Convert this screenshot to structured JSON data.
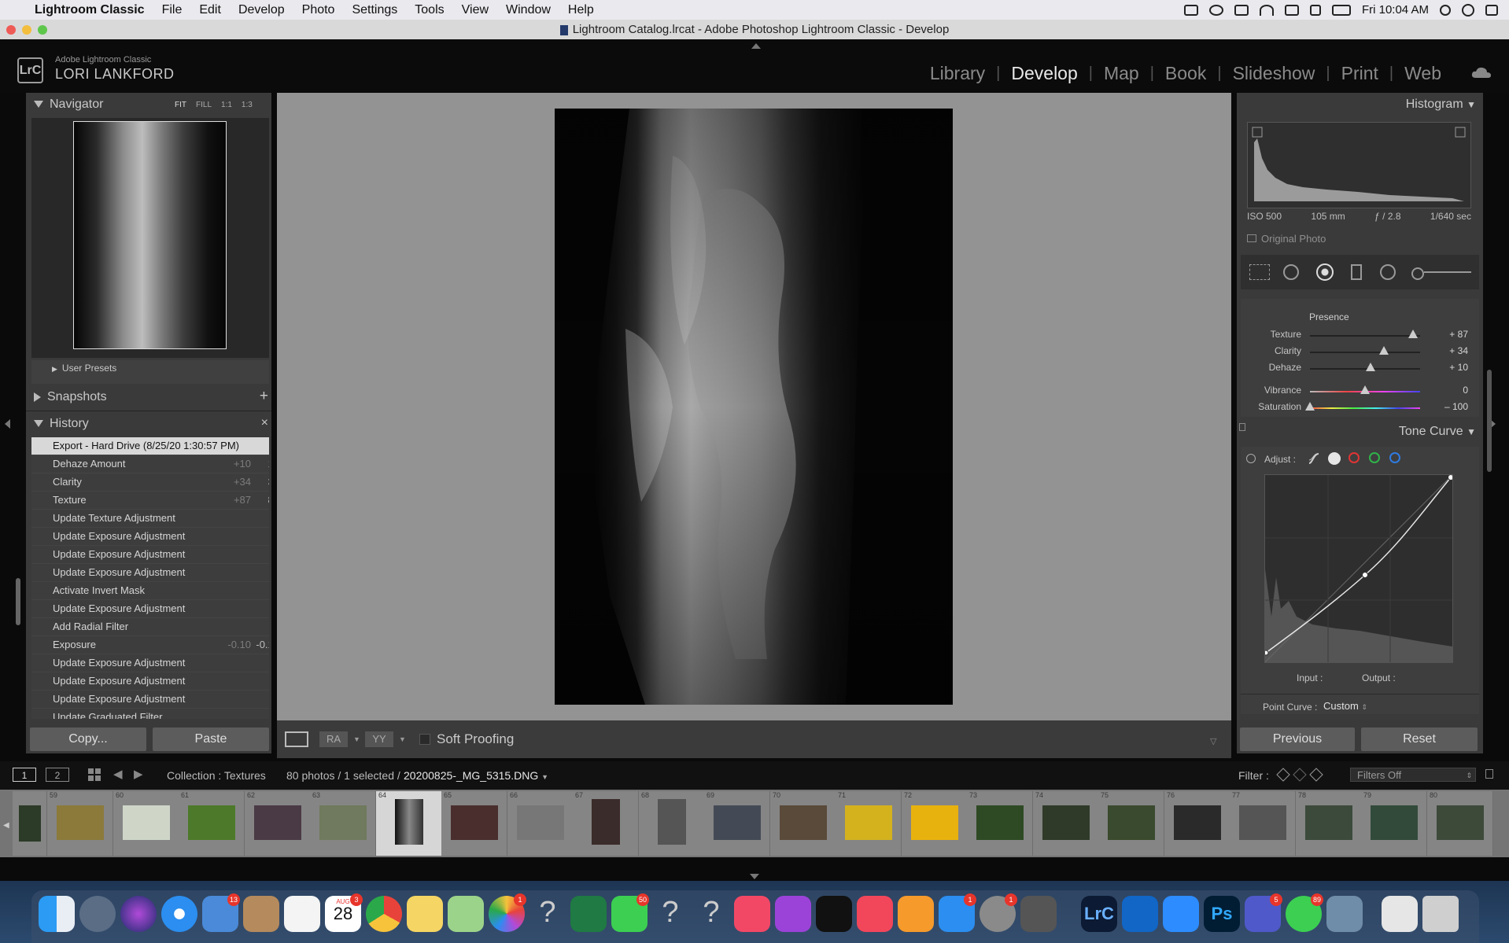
{
  "menubar": {
    "app": "Lightroom Classic",
    "items": [
      "File",
      "Edit",
      "Develop",
      "Photo",
      "Settings",
      "Tools",
      "View",
      "Window",
      "Help"
    ],
    "clock": "Fri 10:04 AM"
  },
  "window": {
    "title": "Lightroom Catalog.lrcat - Adobe Photoshop Lightroom Classic - Develop"
  },
  "brand": {
    "logo": "LrC",
    "line1": "Adobe Lightroom Classic",
    "line2": "LORI LANKFORD"
  },
  "modules": [
    "Library",
    "Develop",
    "Map",
    "Book",
    "Slideshow",
    "Print",
    "Web"
  ],
  "active_module": "Develop",
  "navigator": {
    "title": "Navigator",
    "zoom": [
      "FIT",
      "FILL",
      "1:1",
      "1:3"
    ]
  },
  "presets": {
    "user_presets": "User Presets"
  },
  "snapshots": {
    "title": "Snapshots",
    "add": "+"
  },
  "history": {
    "title": "History",
    "close": "×",
    "items": [
      {
        "label": "Export - Hard Drive (8/25/20 1:30:57 PM)",
        "delta": "",
        "value": ""
      },
      {
        "label": "Dehaze Amount",
        "delta": "+10",
        "value": "10"
      },
      {
        "label": "Clarity",
        "delta": "+34",
        "value": "34"
      },
      {
        "label": "Texture",
        "delta": "+87",
        "value": "87"
      },
      {
        "label": "Update Texture Adjustment",
        "delta": "",
        "value": ""
      },
      {
        "label": "Update Exposure Adjustment",
        "delta": "",
        "value": ""
      },
      {
        "label": "Update Exposure Adjustment",
        "delta": "",
        "value": ""
      },
      {
        "label": "Update Exposure Adjustment",
        "delta": "",
        "value": ""
      },
      {
        "label": "Activate Invert Mask",
        "delta": "",
        "value": ""
      },
      {
        "label": "Update Exposure Adjustment",
        "delta": "",
        "value": ""
      },
      {
        "label": "Add Radial Filter",
        "delta": "",
        "value": ""
      },
      {
        "label": "Exposure",
        "delta": "-0.10",
        "value": "-0.10"
      },
      {
        "label": "Update Exposure Adjustment",
        "delta": "",
        "value": ""
      },
      {
        "label": "Update Exposure Adjustment",
        "delta": "",
        "value": ""
      },
      {
        "label": "Update Exposure Adjustment",
        "delta": "",
        "value": ""
      },
      {
        "label": "Update Graduated Filter",
        "delta": "",
        "value": ""
      }
    ]
  },
  "left_buttons": {
    "copy": "Copy...",
    "paste": "Paste"
  },
  "toolbar": {
    "soft_proofing": "Soft Proofing"
  },
  "histogram": {
    "title": "Histogram",
    "iso": "ISO 500",
    "focal": "105 mm",
    "aperture": "ƒ / 2.8",
    "shutter": "1/640 sec",
    "original_photo": "Original Photo"
  },
  "presence": {
    "title": "Presence",
    "sliders": [
      {
        "label": "Texture",
        "value": "+ 87",
        "fraction": 0.935
      },
      {
        "label": "Clarity",
        "value": "+ 34",
        "fraction": 0.67
      },
      {
        "label": "Dehaze",
        "value": "+ 10",
        "fraction": 0.55
      },
      {
        "label": "Vibrance",
        "value": "0",
        "fraction": 0.5
      },
      {
        "label": "Saturation",
        "value": "– 100",
        "fraction": 0.0
      }
    ]
  },
  "tone_curve": {
    "title": "Tone Curve",
    "adjust": "Adjust :",
    "input": "Input :",
    "output": "Output :",
    "point_curve_label": "Point Curve :",
    "point_curve_value": "Custom"
  },
  "right_buttons": {
    "previous": "Previous",
    "reset": "Reset"
  },
  "filmbar": {
    "view1": "1",
    "view2": "2",
    "collection": "Collection : Textures",
    "count": "80 photos / 1 selected /",
    "filename": "20200825-_MG_5315.DNG",
    "filter_label": "Filter :",
    "filter_value": "Filters Off"
  },
  "filmstrip": {
    "numbers": [
      "59",
      "60",
      "61",
      "62",
      "63",
      "64",
      "65",
      "66",
      "67",
      "68",
      "69",
      "70",
      "71",
      "72",
      "73",
      "74",
      "75",
      "76",
      "77",
      "78",
      "79",
      "80"
    ],
    "selected": "64"
  },
  "dock": {
    "calendar_month": "AUG",
    "calendar_day": "28",
    "badges": {
      "mail": "13",
      "calendar": "3",
      "photos": "1",
      "facetime": "50",
      "appstore": "1",
      "prefs": "1",
      "teams": "5",
      "messages": "89"
    }
  }
}
